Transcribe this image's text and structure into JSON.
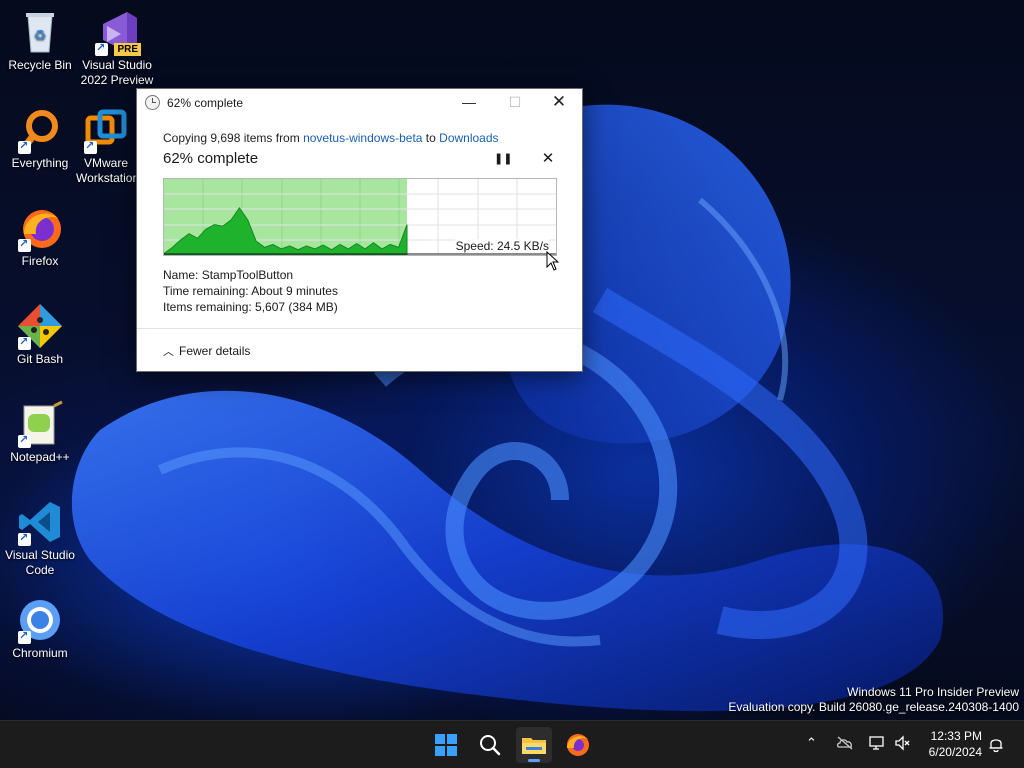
{
  "desktop": {
    "icons": [
      {
        "label": "Recycle Bin"
      },
      {
        "label": "Visual Studio 2022 Preview",
        "badge": "PRE"
      },
      {
        "label": "Everything"
      },
      {
        "label": "VMware Workstation"
      },
      {
        "label": "Firefox"
      },
      {
        "label": "Git Bash"
      },
      {
        "label": "Notepad++"
      },
      {
        "label": "Visual Studio Code"
      },
      {
        "label": "Chromium"
      }
    ],
    "watermark": {
      "line1": "Windows 11 Pro Insider Preview",
      "line2": "Evaluation copy. Build 26080.ge_release.240308-1400"
    }
  },
  "dialog": {
    "title": "62% complete",
    "copy_prefix": "Copying 9,698 items from ",
    "source": "novetus-windows-beta",
    "copy_to": " to ",
    "destination": "Downloads",
    "heading": "62% complete",
    "progress": 0.62,
    "speed": "Speed: 24.5 KB/s",
    "details": {
      "name_label": "Name:",
      "name_value": "StampToolButton",
      "time_label": "Time remaining:",
      "time_value": "About 9 minutes",
      "items_label": "Items remaining:",
      "items_value": "5,607 (384 MB)"
    },
    "fewer_details": "Fewer details",
    "buttons": {
      "minimize": "—",
      "maximize": "☐",
      "close": "✕",
      "pause": "❚❚",
      "cancel": "✕"
    }
  },
  "taskbar": {
    "clock_time": "12:33 PM",
    "clock_date": "6/20/2024"
  },
  "colors": {
    "progress_fill": "#a8e6a0",
    "speed_fill": "#1fb32d",
    "link": "#1a5fb4",
    "taskbar": "#1c1c1c"
  }
}
